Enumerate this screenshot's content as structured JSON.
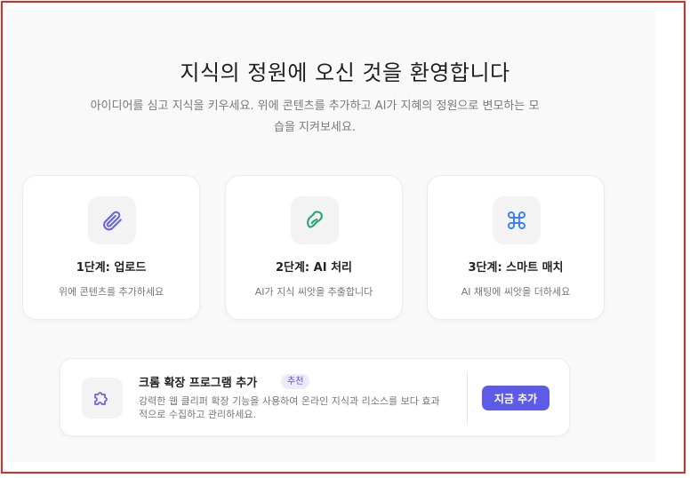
{
  "hero": {
    "title": "지식의 정원에 오신 것을 환영합니다",
    "subtitle": "아이디어를 심고 지식을 키우세요. 위에 콘텐츠를 추가하고 AI가 지혜의 정원으로 변모하는 모습을 지켜보세요."
  },
  "steps": [
    {
      "icon": "paperclip-icon",
      "icon_color": "#6b67d8",
      "title": "1단계: 업로드",
      "desc": "위에 콘텐츠를 추가하세요"
    },
    {
      "icon": "seed-icon",
      "icon_color": "#2aa770",
      "title": "2단계: AI 처리",
      "desc": "AI가 지식 씨앗을 추출합니다"
    },
    {
      "icon": "command-icon",
      "icon_color": "#3b82f6",
      "title": "3단계: 스마트 매치",
      "desc": "AI 채팅에 씨앗을 더하세요"
    }
  ],
  "extension": {
    "icon": "puzzle-icon",
    "title": "크롬 확장 프로그램 추가",
    "badge": "추천",
    "desc": "강력한 웹 클리퍼 확장 기능을 사용하여 온라인 지식과 리소스를 보다 효과적으로 수집하고 관리하세요.",
    "button_label": "지금 추가"
  },
  "colors": {
    "accent": "#5d5ce6",
    "frame": "#e02a2a"
  }
}
